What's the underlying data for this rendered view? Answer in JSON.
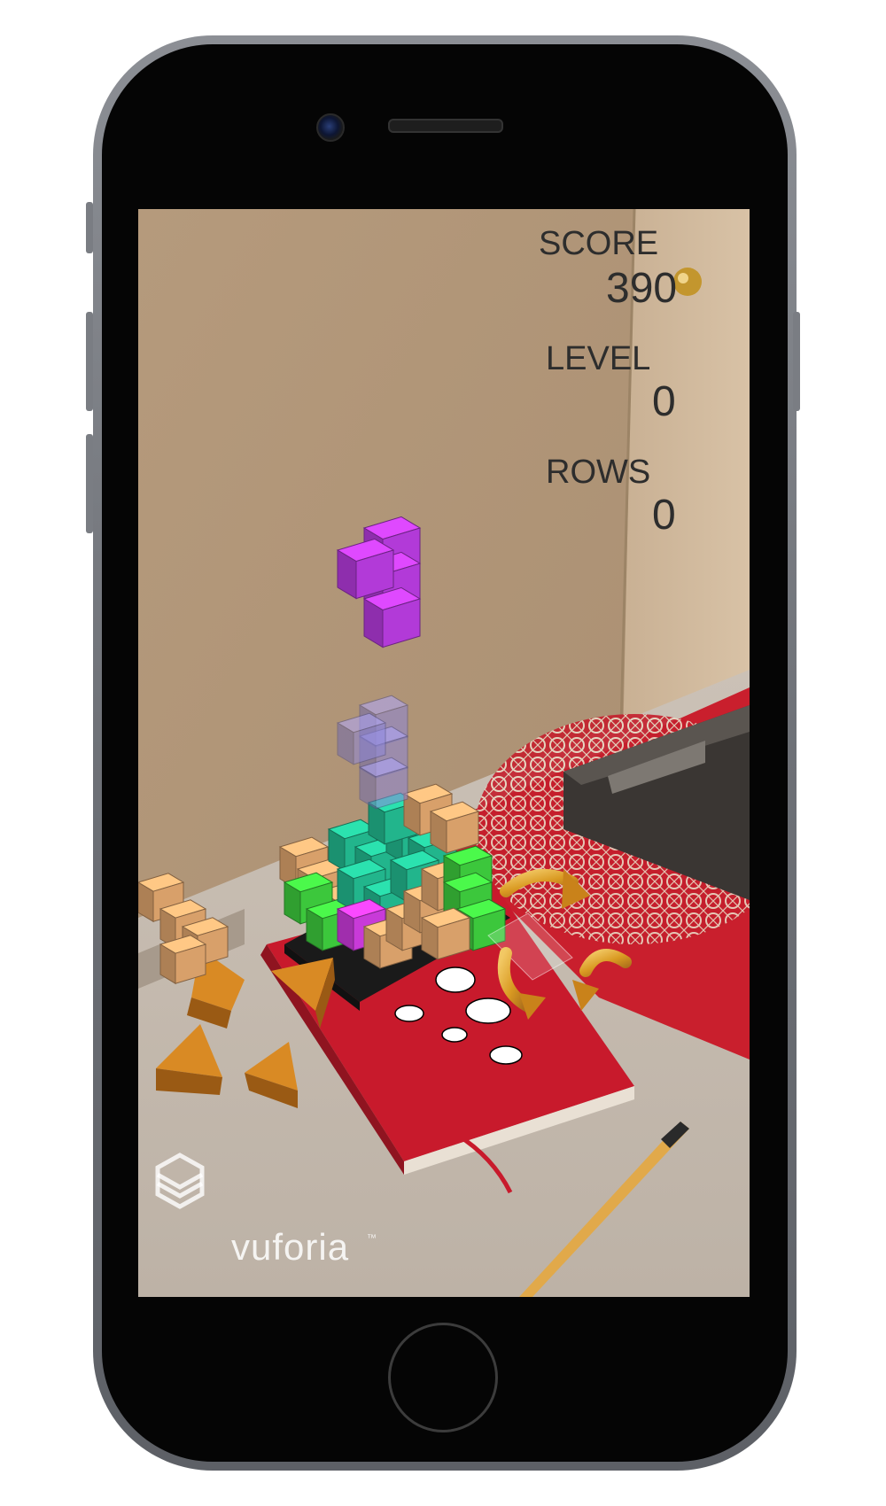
{
  "hud": {
    "score_label": "SCORE",
    "score_value": "390",
    "level_label": "LEVEL",
    "level_value": "0",
    "rows_label": "ROWS",
    "rows_value": "0"
  },
  "branding": {
    "logo_text": "vuforia",
    "trademark": "™"
  },
  "controls": {
    "move_arrows": [
      "move-up",
      "move-right",
      "move-left",
      "move-down"
    ],
    "rotate_arrows": [
      "rotate-x",
      "rotate-y",
      "rotate-z"
    ]
  },
  "colors": {
    "active_piece": "#b23ad8",
    "ghost_piece": "#8d86d8",
    "block_teal": "#22b58c",
    "block_green": "#3cc73c",
    "block_orange": "#d8a06a",
    "block_magenta": "#c83ad8",
    "arrow_orange": "#d98a24",
    "rotate_gold": "#d9a020"
  }
}
